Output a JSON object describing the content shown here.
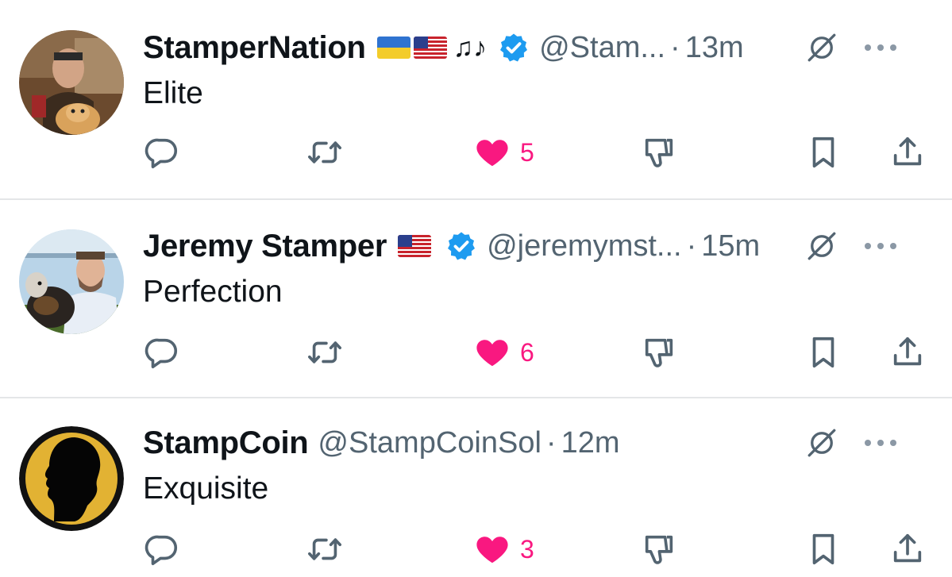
{
  "tweets": [
    {
      "name": "StamperNation",
      "emoji": [
        "ukraine-flag",
        "us-flag",
        "music-notes"
      ],
      "music_notes": "♫♪",
      "verified": true,
      "handle": "@Stam...",
      "separator": "·",
      "time": "13m",
      "text": "Elite",
      "likes": "5",
      "liked": true
    },
    {
      "name": "Jeremy Stamper",
      "emoji": [
        "us-flag"
      ],
      "verified": true,
      "handle": "@jeremymst...",
      "separator": "·",
      "time": "15m",
      "text": "Perfection",
      "likes": "6",
      "liked": true
    },
    {
      "name": "StampCoin",
      "emoji": [],
      "verified": false,
      "handle": "@StampCoinSol",
      "separator": "·",
      "time": "12m",
      "text": "Exquisite",
      "likes": "3",
      "liked": true
    }
  ],
  "colors": {
    "like": "#f91880",
    "icon": "#536471",
    "verified": "#1d9bf0",
    "divider": "#e4e6e8"
  },
  "icons": [
    "reply-icon",
    "retweet-icon",
    "heart-icon",
    "dislike-icon",
    "bookmark-icon",
    "share-icon",
    "grok-icon",
    "more-icon",
    "verified-icon"
  ]
}
